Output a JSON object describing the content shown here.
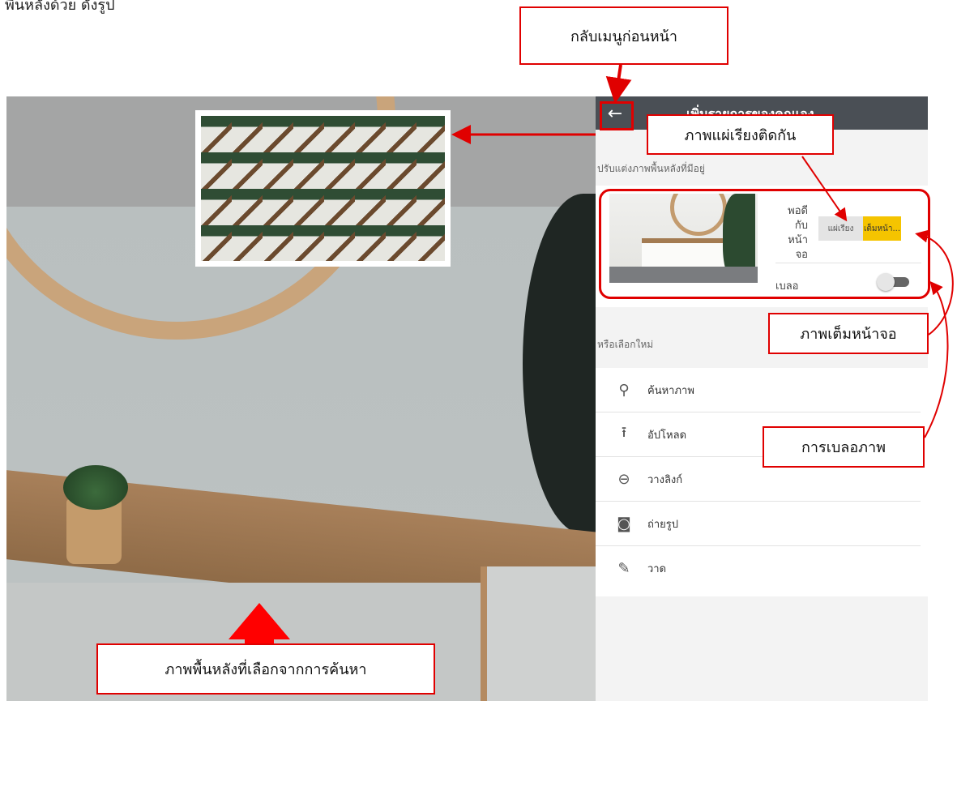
{
  "top_caption": "พื้นหลังด้วย ดังรูป",
  "panel": {
    "title": "เพิ่มรายการของคุณเอง",
    "back_icon": "←",
    "subtitle": "ปรับแต่งภาพพื้นหลังที่มีอยู่",
    "fit_label": "พอดีกับหน้าจอ",
    "segment": {
      "tile": "แผ่เรียง",
      "full": "เต็มหน้า...",
      "selected": "full"
    },
    "blur_label": "เบลอ",
    "blur_on": false,
    "or_label": "หรือเลือกใหม่",
    "menu": [
      {
        "icon": "search-icon",
        "glyph": "⚲",
        "label": "ค้นหาภาพ"
      },
      {
        "icon": "upload-icon",
        "glyph": "⭱",
        "label": "อัปโหลด"
      },
      {
        "icon": "link-icon",
        "glyph": "⊖",
        "label": "วางลิงก์"
      },
      {
        "icon": "camera-icon",
        "glyph": "◙",
        "label": "ถ่ายรูป"
      },
      {
        "icon": "draw-icon",
        "glyph": "✎",
        "label": "วาด"
      }
    ]
  },
  "annotations": {
    "back": "กลับเมนูก่อนหน้า",
    "tiled": "ภาพแผ่เรียงติดกัน",
    "fullscreen": "ภาพเต็มหน้าจอ",
    "blur": "การเบลอภาพ",
    "selected_bg": "ภาพพื้นหลังที่เลือกจากการค้นหา"
  },
  "colors": {
    "accent": "#f5c400",
    "annotation": "#e00000",
    "header": "#4a4f55"
  }
}
